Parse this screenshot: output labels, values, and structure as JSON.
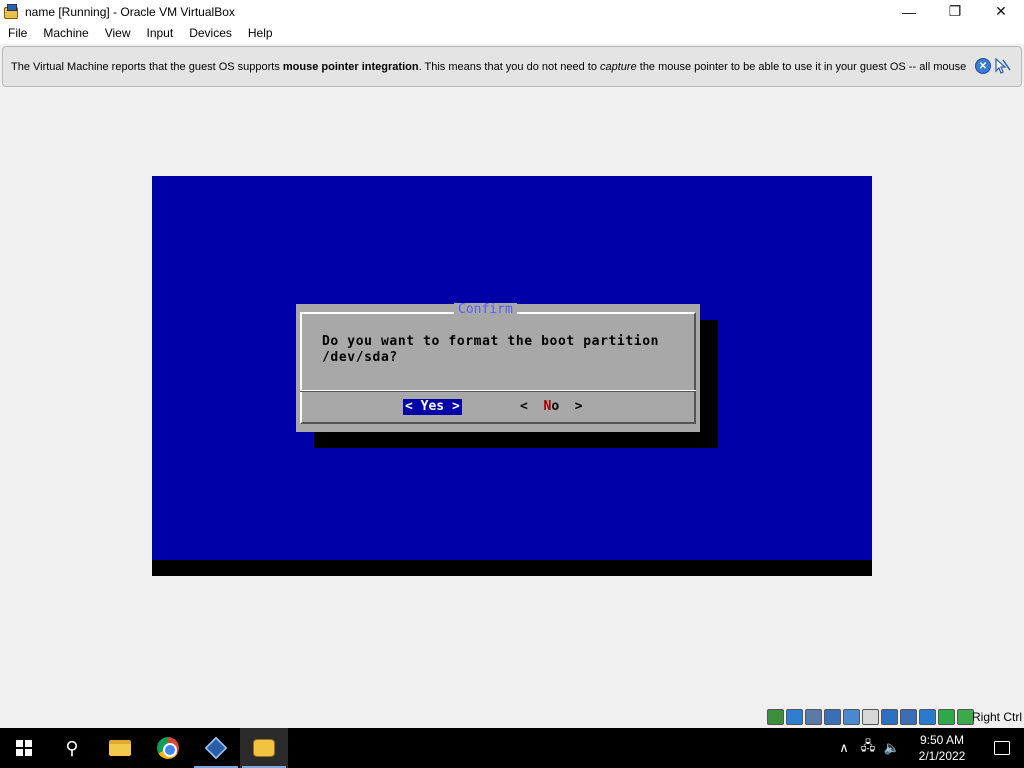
{
  "window": {
    "title": "name  [Running] - Oracle VM VirtualBox",
    "minimize_glyph": "—",
    "restore_glyph": "❐",
    "close_glyph": "✕"
  },
  "menu": {
    "file": "File",
    "machine": "Machine",
    "view": "View",
    "input": "Input",
    "devices": "Devices",
    "help": "Help"
  },
  "notification": {
    "part1": "The Virtual Machine reports that the guest OS supports ",
    "bold": "mouse pointer integration",
    "part2": ". This means that you do not need to ",
    "italic": "capture",
    "part3": " the mouse pointer to be able to use it in your guest OS -- all mouse",
    "close_glyph": "✕"
  },
  "dialog": {
    "title": "Confirm",
    "message": "Do you want to format the boot partition\n/dev/sda?",
    "yes_label": "< Yes >",
    "no_left": "<  ",
    "no_hot": "N",
    "no_rest": "o",
    "no_right": "  >"
  },
  "statusbar": {
    "host_key": "Right Ctrl",
    "icons": [
      "hard-disk-icon",
      "optical-disk-icon",
      "audio-icon",
      "network-icon",
      "usb-icon",
      "shared-folders-icon",
      "display-icon",
      "video-capture-icon",
      "cpu-icon",
      "globe-icon",
      "mouse-integration-icon"
    ],
    "icon_colors": [
      "#3d8f3d",
      "#2e7fd1",
      "#5c7aa8",
      "#3a6fb8",
      "#4a88d0",
      "#d8d8d8",
      "#2e6fc0",
      "#3a6fb8",
      "#2a7ad0",
      "#2fa84a",
      "#3caa4a"
    ]
  },
  "taskbar": {
    "search_glyph": "⚲",
    "tray_chevron": "∧",
    "network_glyph": "🖧",
    "volume_glyph": "🔈",
    "time": "9:50 AM",
    "date": "2/1/2022"
  }
}
